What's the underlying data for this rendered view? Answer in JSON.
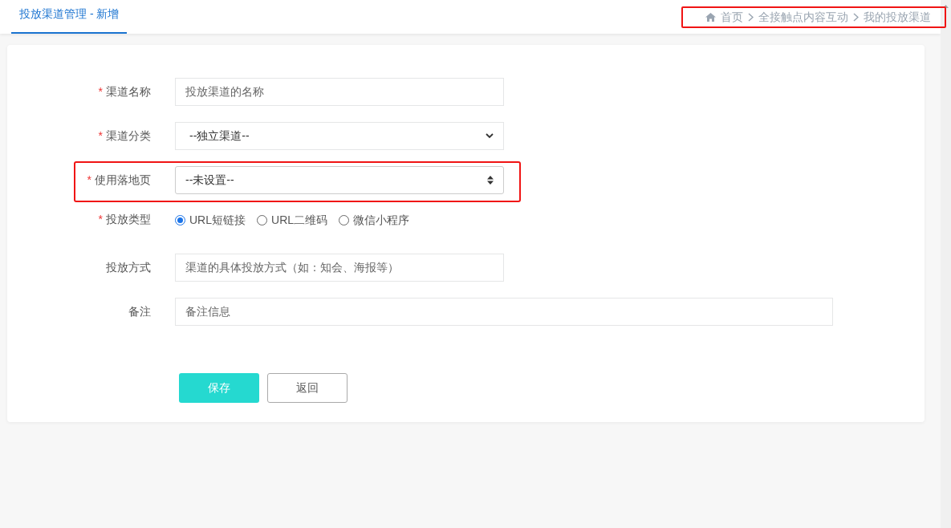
{
  "tab": {
    "label": "投放渠道管理 - 新增",
    "selected": true
  },
  "breadcrumb": [
    "首页",
    "全接触点内容互动",
    "我的投放渠道"
  ],
  "form": {
    "fields": [
      {
        "kind": "text",
        "label": "渠道名称",
        "required_mark": "*",
        "placeholder": "投放渠道的名称",
        "wide": false
      },
      {
        "kind": "select",
        "label": "渠道分类",
        "required_mark": "*",
        "value": "--独立渠道--",
        "wide": false
      },
      {
        "kind": "spinner",
        "label": "使用落地页",
        "required_mark": "*",
        "value": "--未设置--",
        "wide": false,
        "highlighted": true
      },
      {
        "kind": "radio",
        "label": "投放类型",
        "required_mark": "*",
        "options": [
          {
            "label": "URL短链接",
            "selected": true
          },
          {
            "label": "URL二维码",
            "selected": false
          },
          {
            "label": "微信小程序",
            "selected": false
          }
        ]
      },
      {
        "kind": "text",
        "label": "投放方式",
        "placeholder": "渠道的具体投放方式（如：知会、海报等）",
        "wide": false
      },
      {
        "kind": "text",
        "label": "备注",
        "placeholder": "备注信息",
        "wide": true
      }
    ]
  },
  "buttons": [
    {
      "kind": "primary",
      "label": "保存"
    },
    {
      "kind": "default",
      "label": "返回"
    }
  ]
}
